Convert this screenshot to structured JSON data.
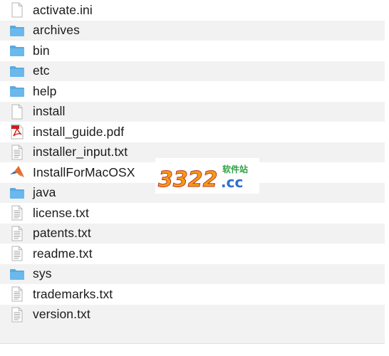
{
  "files": [
    {
      "name": "activate.ini",
      "icon": "document-icon"
    },
    {
      "name": "archives",
      "icon": "folder-icon"
    },
    {
      "name": "bin",
      "icon": "folder-icon"
    },
    {
      "name": "etc",
      "icon": "folder-icon"
    },
    {
      "name": "help",
      "icon": "folder-icon"
    },
    {
      "name": "install",
      "icon": "document-icon"
    },
    {
      "name": "install_guide.pdf",
      "icon": "pdf-icon"
    },
    {
      "name": "installer_input.txt",
      "icon": "text-document-icon"
    },
    {
      "name": "InstallForMacOSX",
      "icon": "matlab-icon"
    },
    {
      "name": "java",
      "icon": "folder-icon"
    },
    {
      "name": "license.txt",
      "icon": "text-document-icon"
    },
    {
      "name": "patents.txt",
      "icon": "text-document-icon"
    },
    {
      "name": "readme.txt",
      "icon": "text-document-icon"
    },
    {
      "name": "sys",
      "icon": "folder-icon"
    },
    {
      "name": "trademarks.txt",
      "icon": "text-document-icon"
    },
    {
      "name": "version.txt",
      "icon": "text-document-icon"
    }
  ],
  "watermark": {
    "main": "3322",
    "suffix": ".cc",
    "tag": "软件站"
  },
  "colors": {
    "folder": "#6ab8ec",
    "folder_tab": "#5aa9de",
    "alt_row": "#f2f2f2",
    "text": "#1a1a1a",
    "pdf_red": "#c8201e",
    "matlab_orange": "#e2702a",
    "matlab_blue": "#1f5fa8",
    "watermark_orange": "#f39c12",
    "watermark_blue": "#2f6fd0",
    "watermark_green": "#2ea043"
  }
}
